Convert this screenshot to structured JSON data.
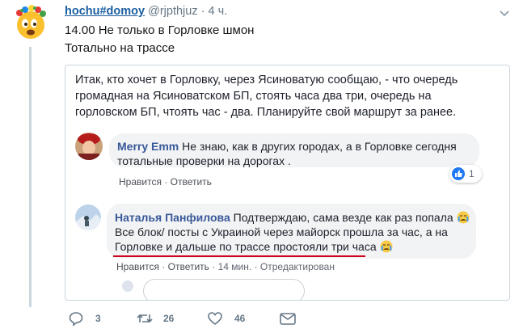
{
  "tweet": {
    "display_name": "hochu#domoy",
    "handle": "@rjpthjuz",
    "separator": "·",
    "time": "4 ч.",
    "lines": [
      "14.00 Не только в Горловке шмон",
      "Тотально на трассе"
    ]
  },
  "post": {
    "lines": [
      "Итак, кто хочет в Горловку, через Ясиноватую сообщаю, - что очередь",
      "громадная на Ясиноватском БП, стоять часа два три, очередь на",
      "горловском БП, чтоять час - два. Планируйте свой маршрут за ранее."
    ]
  },
  "comments": [
    {
      "author": "Merry Emm",
      "lines": [
        "Не знаю, как в других городах, а в Горловке сегодня",
        "тотальные проверки на дорогах ."
      ],
      "like_label": "Нравится",
      "reply_label": "Ответить",
      "dot": "·",
      "reaction_count": "1"
    },
    {
      "author": "Наталья Панфилова",
      "lines": [
        "Подтверждаю, сама везде как раз попала",
        "Все блок/ посты с Украиной через майорск прошла за час, а на",
        "Горловке и дальше по трассе простояли три часа"
      ],
      "like_label": "Нравится",
      "reply_label": "Ответить",
      "dot": "·",
      "time": "14 мин.",
      "edited": "Отредактирован"
    }
  ],
  "actions": {
    "replies": "3",
    "retweets": "26",
    "likes": "46"
  },
  "colors": {
    "name_link": "#1c5fa0",
    "fb_author": "#385898",
    "underline": "#d0021b",
    "bubble": "#f2f3f5",
    "like_blue": "#2078f4"
  }
}
